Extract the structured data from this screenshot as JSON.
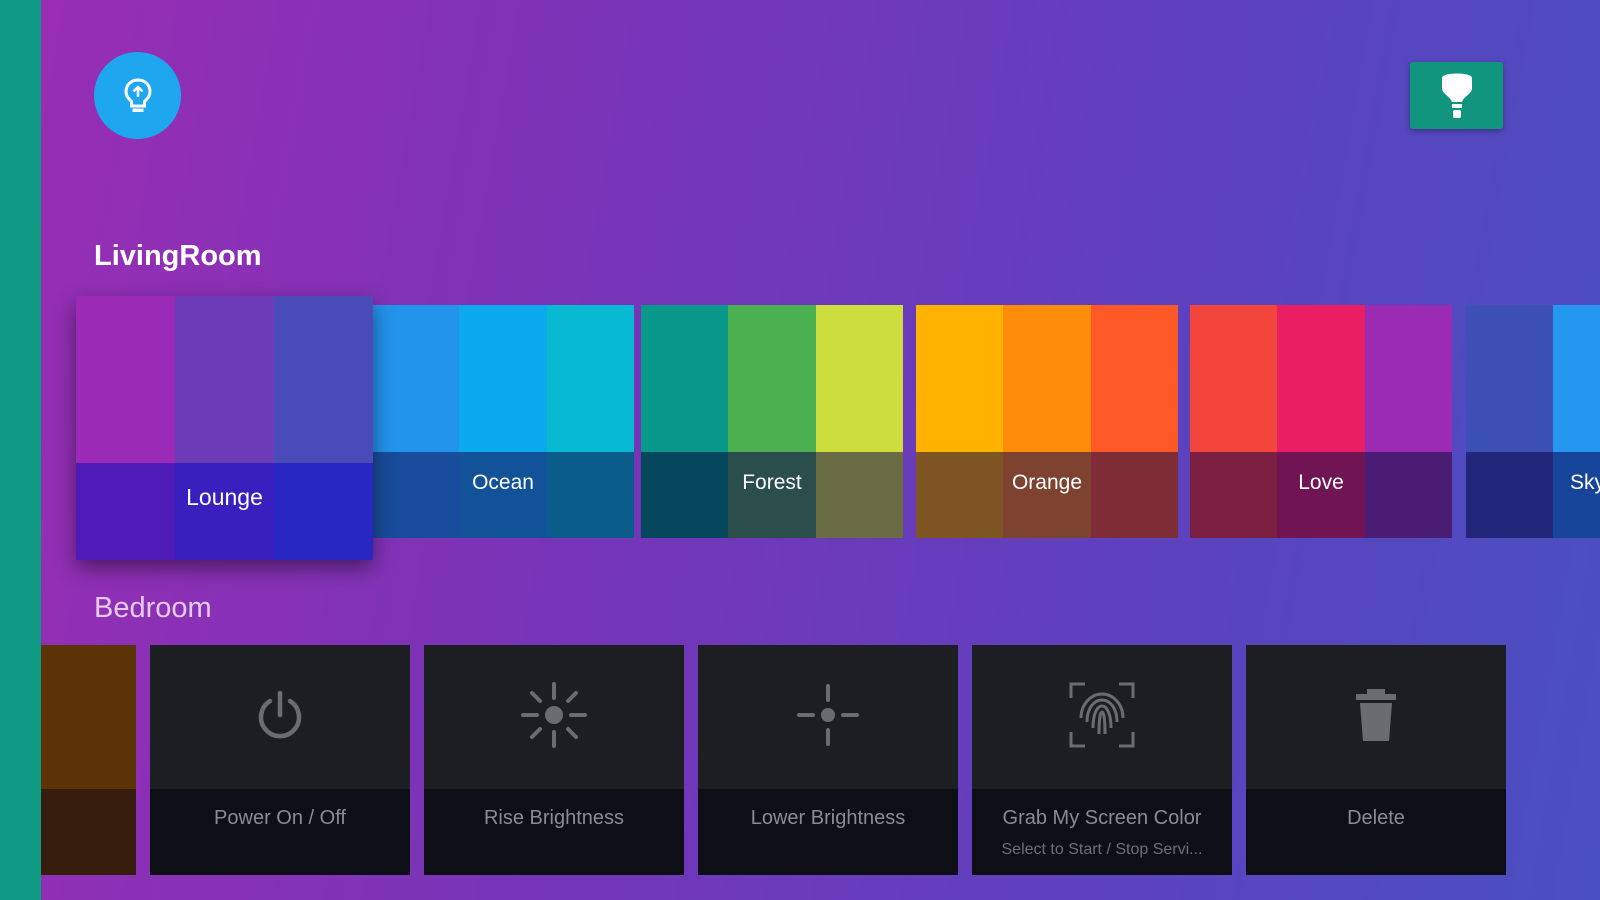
{
  "colors": {
    "rail": "#0f9a83",
    "bulb_button": "#1ea7ee",
    "lamp_button": "#12957e",
    "action_card": "#1d1e22",
    "action_footer": "#0d0e16"
  },
  "header": {
    "left_icon": "lightbulb-icon",
    "right_icon": "lamp-bulb-icon"
  },
  "sections": {
    "living_room": "LivingRoom",
    "bedroom": "Bedroom"
  },
  "scenes": [
    {
      "label": "Lounge",
      "top_colors": [
        "#9b2ab6",
        "#6d3bb8",
        "#4a4bb9"
      ],
      "bottom_colors": [
        "#4f1bb8",
        "#3a1fbf",
        "#2827c2"
      ]
    },
    {
      "label": "Ocean",
      "top_colors": [
        "#2394ec",
        "#0ca9ee",
        "#07bad2"
      ],
      "bottom_colors": [
        "#184c9c",
        "#115298",
        "#0a5c8a"
      ]
    },
    {
      "label": "Forest",
      "top_colors": [
        "#09998a",
        "#4bb050",
        "#cddd3e"
      ],
      "bottom_colors": [
        "#05485e",
        "#294e4b",
        "#6a6c43"
      ]
    },
    {
      "label": "Orange",
      "top_colors": [
        "#ffb300",
        "#fc8c0a",
        "#fd5926"
      ],
      "bottom_colors": [
        "#7e5423",
        "#7e4330",
        "#7e2c36"
      ]
    },
    {
      "label": "Love",
      "top_colors": [
        "#f2463c",
        "#e91e63",
        "#9a2bb2"
      ],
      "bottom_colors": [
        "#7b2040",
        "#701454",
        "#4b1c74"
      ]
    },
    {
      "label": "Sky",
      "top_colors": [
        "#3d50b5",
        "#2497f0"
      ],
      "bottom_colors": [
        "#23277a",
        "#16459a"
      ]
    }
  ],
  "actions": [
    {
      "title": "Power On / Off",
      "subtitle": "",
      "icon": "power-icon"
    },
    {
      "title": "Rise Brightness",
      "subtitle": "",
      "icon": "brightness-high-icon"
    },
    {
      "title": "Lower Brightness",
      "subtitle": "",
      "icon": "brightness-low-icon"
    },
    {
      "title": "Grab My Screen Color",
      "subtitle": "Select to Start / Stop Servi...",
      "icon": "fingerprint-scan-icon"
    },
    {
      "title": "Delete",
      "subtitle": "",
      "icon": "trash-icon"
    }
  ]
}
